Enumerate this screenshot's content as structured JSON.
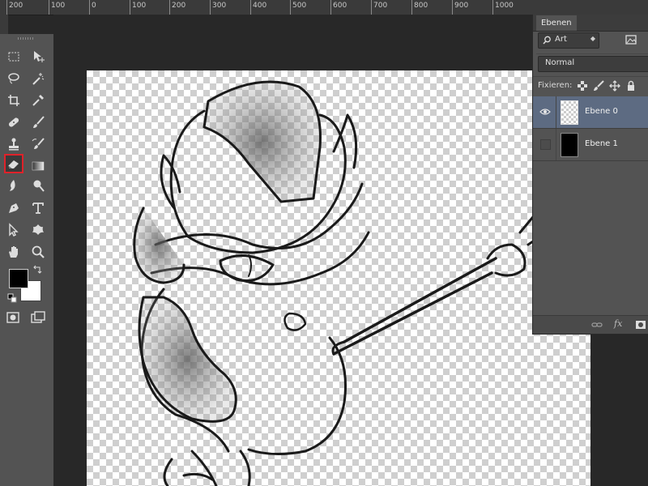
{
  "ruler": {
    "labels": [
      "200",
      "100",
      "0",
      "100",
      "200",
      "300",
      "400",
      "500",
      "600",
      "700",
      "800",
      "900",
      "1000"
    ]
  },
  "toolbox": {
    "active_tool": "eraser-tool",
    "foreground_color": "#000000",
    "background_color": "#ffffff",
    "highlight_color": "#e0222a"
  },
  "layers_panel": {
    "tab_label": "Ebenen",
    "filter_label": "Art",
    "blend_mode": "Normal",
    "lock_label": "Fixieren:",
    "layers": [
      {
        "name": "Ebene 0",
        "selected": true,
        "visible": true,
        "thumb": "transparent-sketch"
      },
      {
        "name": "Ebene 1",
        "selected": false,
        "visible": false,
        "thumb": "black-fill"
      }
    ],
    "footer_icons": [
      "link-icon",
      "fx-icon",
      "mask-icon"
    ],
    "fx_label": "fx"
  },
  "canvas": {
    "content": "pencil sketch of a masked character holding a staff on transparent background"
  }
}
